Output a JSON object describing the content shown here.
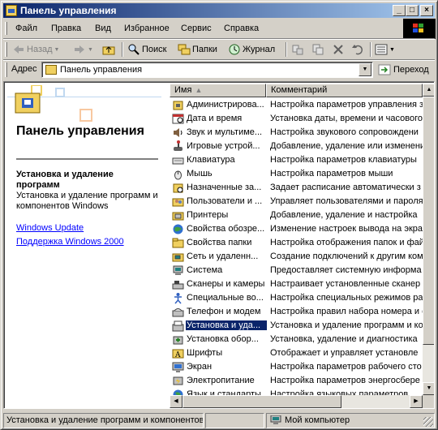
{
  "window": {
    "title": "Панель управления",
    "controls": {
      "minimize": "_",
      "maximize": "□",
      "close": "×"
    }
  },
  "menu": [
    "Файл",
    "Правка",
    "Вид",
    "Избранное",
    "Сервис",
    "Справка"
  ],
  "toolbar": {
    "back": "Назад",
    "search": "Поиск",
    "folders": "Папки",
    "history": "Журнал"
  },
  "address": {
    "label": "Адрес",
    "value": "Панель управления",
    "go": "Переход"
  },
  "left_pane": {
    "title": "Панель управления",
    "selected_title": "Установка и удаление программ",
    "selected_desc": "Установка и удаление программ и компонентов Windows",
    "links": [
      "Windows Update",
      "Поддержка Windows 2000"
    ]
  },
  "list": {
    "columns": {
      "name": "Имя",
      "comment": "Комментарий"
    },
    "items": [
      {
        "name": "Администрирова...",
        "comment": "Настройка параметров управления з",
        "icon": "admin-tools-icon"
      },
      {
        "name": "Дата и время",
        "comment": "Установка даты, времени и часового",
        "icon": "datetime-icon"
      },
      {
        "name": "Звук и мультиме...",
        "comment": "Настройка звукового сопровождени",
        "icon": "sound-icon"
      },
      {
        "name": "Игровые устрой...",
        "comment": "Добавление, удаление или изменени",
        "icon": "gamepad-icon"
      },
      {
        "name": "Клавиатура",
        "comment": "Настройка параметров клавиатуры",
        "icon": "keyboard-icon"
      },
      {
        "name": "Мышь",
        "comment": "Настройка параметров мыши",
        "icon": "mouse-icon"
      },
      {
        "name": "Назначенные за...",
        "comment": "Задает расписание автоматически з",
        "icon": "scheduled-tasks-icon"
      },
      {
        "name": "Пользователи и ...",
        "comment": "Управляет пользователями и пароля",
        "icon": "users-icon"
      },
      {
        "name": "Принтеры",
        "comment": "Добавление, удаление и настройка",
        "icon": "printers-icon"
      },
      {
        "name": "Свойства обозре...",
        "comment": "Изменение настроек вывода на экра",
        "icon": "internet-options-icon"
      },
      {
        "name": "Свойства папки",
        "comment": "Настройка отображения папок и фай",
        "icon": "folder-options-icon"
      },
      {
        "name": "Сеть и удаленн...",
        "comment": "Создание подключений к другим ком",
        "icon": "network-icon"
      },
      {
        "name": "Система",
        "comment": "Предоставляет системную информа",
        "icon": "system-icon"
      },
      {
        "name": "Сканеры и камеры",
        "comment": "Настраивает установленные сканер",
        "icon": "scanner-icon"
      },
      {
        "name": "Специальные во...",
        "comment": "Настройка специальных режимов ра",
        "icon": "accessibility-icon"
      },
      {
        "name": "Телефон и модем",
        "comment": "Настройка правил набора номера и с",
        "icon": "phone-modem-icon"
      },
      {
        "name": "Установка и уда...",
        "comment": "Установка и удаление программ и ко",
        "icon": "add-remove-programs-icon",
        "selected": true
      },
      {
        "name": "Установка обор...",
        "comment": "Установка, удаление и диагностика",
        "icon": "add-hardware-icon"
      },
      {
        "name": "Шрифты",
        "comment": "Отображает и управляет установле",
        "icon": "fonts-icon"
      },
      {
        "name": "Экран",
        "comment": "Настройка параметров рабочего сто",
        "icon": "display-icon"
      },
      {
        "name": "Электропитание",
        "comment": "Настройка параметров энергосбере",
        "icon": "power-icon"
      },
      {
        "name": "Язык и стандарты",
        "comment": "Настройка языковых параметров",
        "icon": "regional-icon"
      }
    ]
  },
  "status": {
    "main": "Установка и удаление программ и компонентов",
    "zone": "Мой компьютер"
  }
}
